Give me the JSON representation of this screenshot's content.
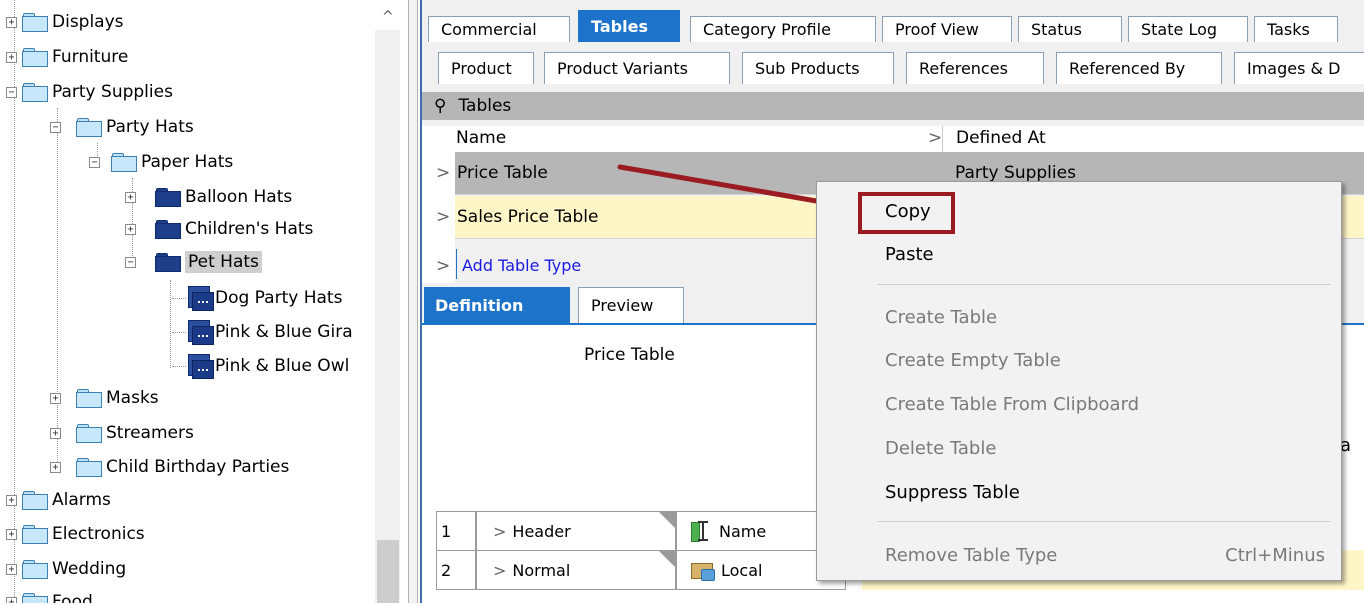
{
  "tree": {
    "items": [
      {
        "label": "Displays",
        "expander": "+"
      },
      {
        "label": "Furniture",
        "expander": "+"
      },
      {
        "label": "Party Supplies",
        "expander": "−"
      },
      {
        "label": "Party Hats",
        "expander": "−"
      },
      {
        "label": "Paper Hats",
        "expander": "−"
      },
      {
        "label": "Balloon Hats",
        "expander": "+"
      },
      {
        "label": "Children's Hats",
        "expander": "+"
      },
      {
        "label": "Pet Hats",
        "expander": "−"
      },
      {
        "label": "Dog Party Hats"
      },
      {
        "label": "Pink & Blue Gira"
      },
      {
        "label": "Pink & Blue Owl"
      },
      {
        "label": "Masks",
        "expander": "+"
      },
      {
        "label": "Streamers",
        "expander": "+"
      },
      {
        "label": "Child Birthday Parties",
        "expander": "+"
      },
      {
        "label": "Alarms",
        "expander": "+"
      },
      {
        "label": "Electronics",
        "expander": "+"
      },
      {
        "label": "Wedding",
        "expander": "+"
      },
      {
        "label": "Food",
        "expander": "+"
      }
    ],
    "scroll_up_glyph": "^"
  },
  "tabs_row1": [
    "Commercial",
    "Tables",
    "Category Profile",
    "Proof View",
    "Status",
    "State Log",
    "Tasks"
  ],
  "tabs_row2": [
    "Product",
    "Product Variants",
    "Sub Products",
    "References",
    "Referenced By",
    "Images & D"
  ],
  "panel": {
    "pin_glyph": "⚲",
    "title": "Tables",
    "columns": [
      "Name",
      "Defined At"
    ],
    "col_sep_glyph": ">",
    "rows": [
      {
        "name": "Price Table",
        "defined_at": "Party Supplies"
      },
      {
        "name": "Sales Price Table",
        "defined_at": ""
      }
    ],
    "row_glyph": ">",
    "add_link": "Add Table Type"
  },
  "sub_tabs": [
    "Definition",
    "Preview"
  ],
  "preview": {
    "title": "Price Table",
    "table_rows": [
      {
        "num": "1",
        "type": "Header",
        "icon": "name-icon",
        "value": "Name"
      },
      {
        "num": "2",
        "type": "Normal",
        "icon": "local-icon",
        "value": "Local"
      }
    ],
    "partial_letter": "a"
  },
  "context_menu": {
    "items": [
      {
        "label": "Copy",
        "enabled": true
      },
      {
        "label": "Paste",
        "enabled": true
      },
      {
        "label": "Create Table",
        "enabled": false
      },
      {
        "label": "Create Empty Table",
        "enabled": false
      },
      {
        "label": "Create Table From Clipboard",
        "enabled": false
      },
      {
        "label": "Delete Table",
        "enabled": false
      },
      {
        "label": "Suppress Table",
        "enabled": true
      },
      {
        "label": "Remove Table Type",
        "enabled": false,
        "shortcut": "Ctrl+Minus"
      }
    ]
  },
  "colors": {
    "accent": "#1c73c9",
    "highlight_row": "#fff6c8",
    "annotation": "#9a1b22",
    "selected_row": "#b6b6b6"
  }
}
